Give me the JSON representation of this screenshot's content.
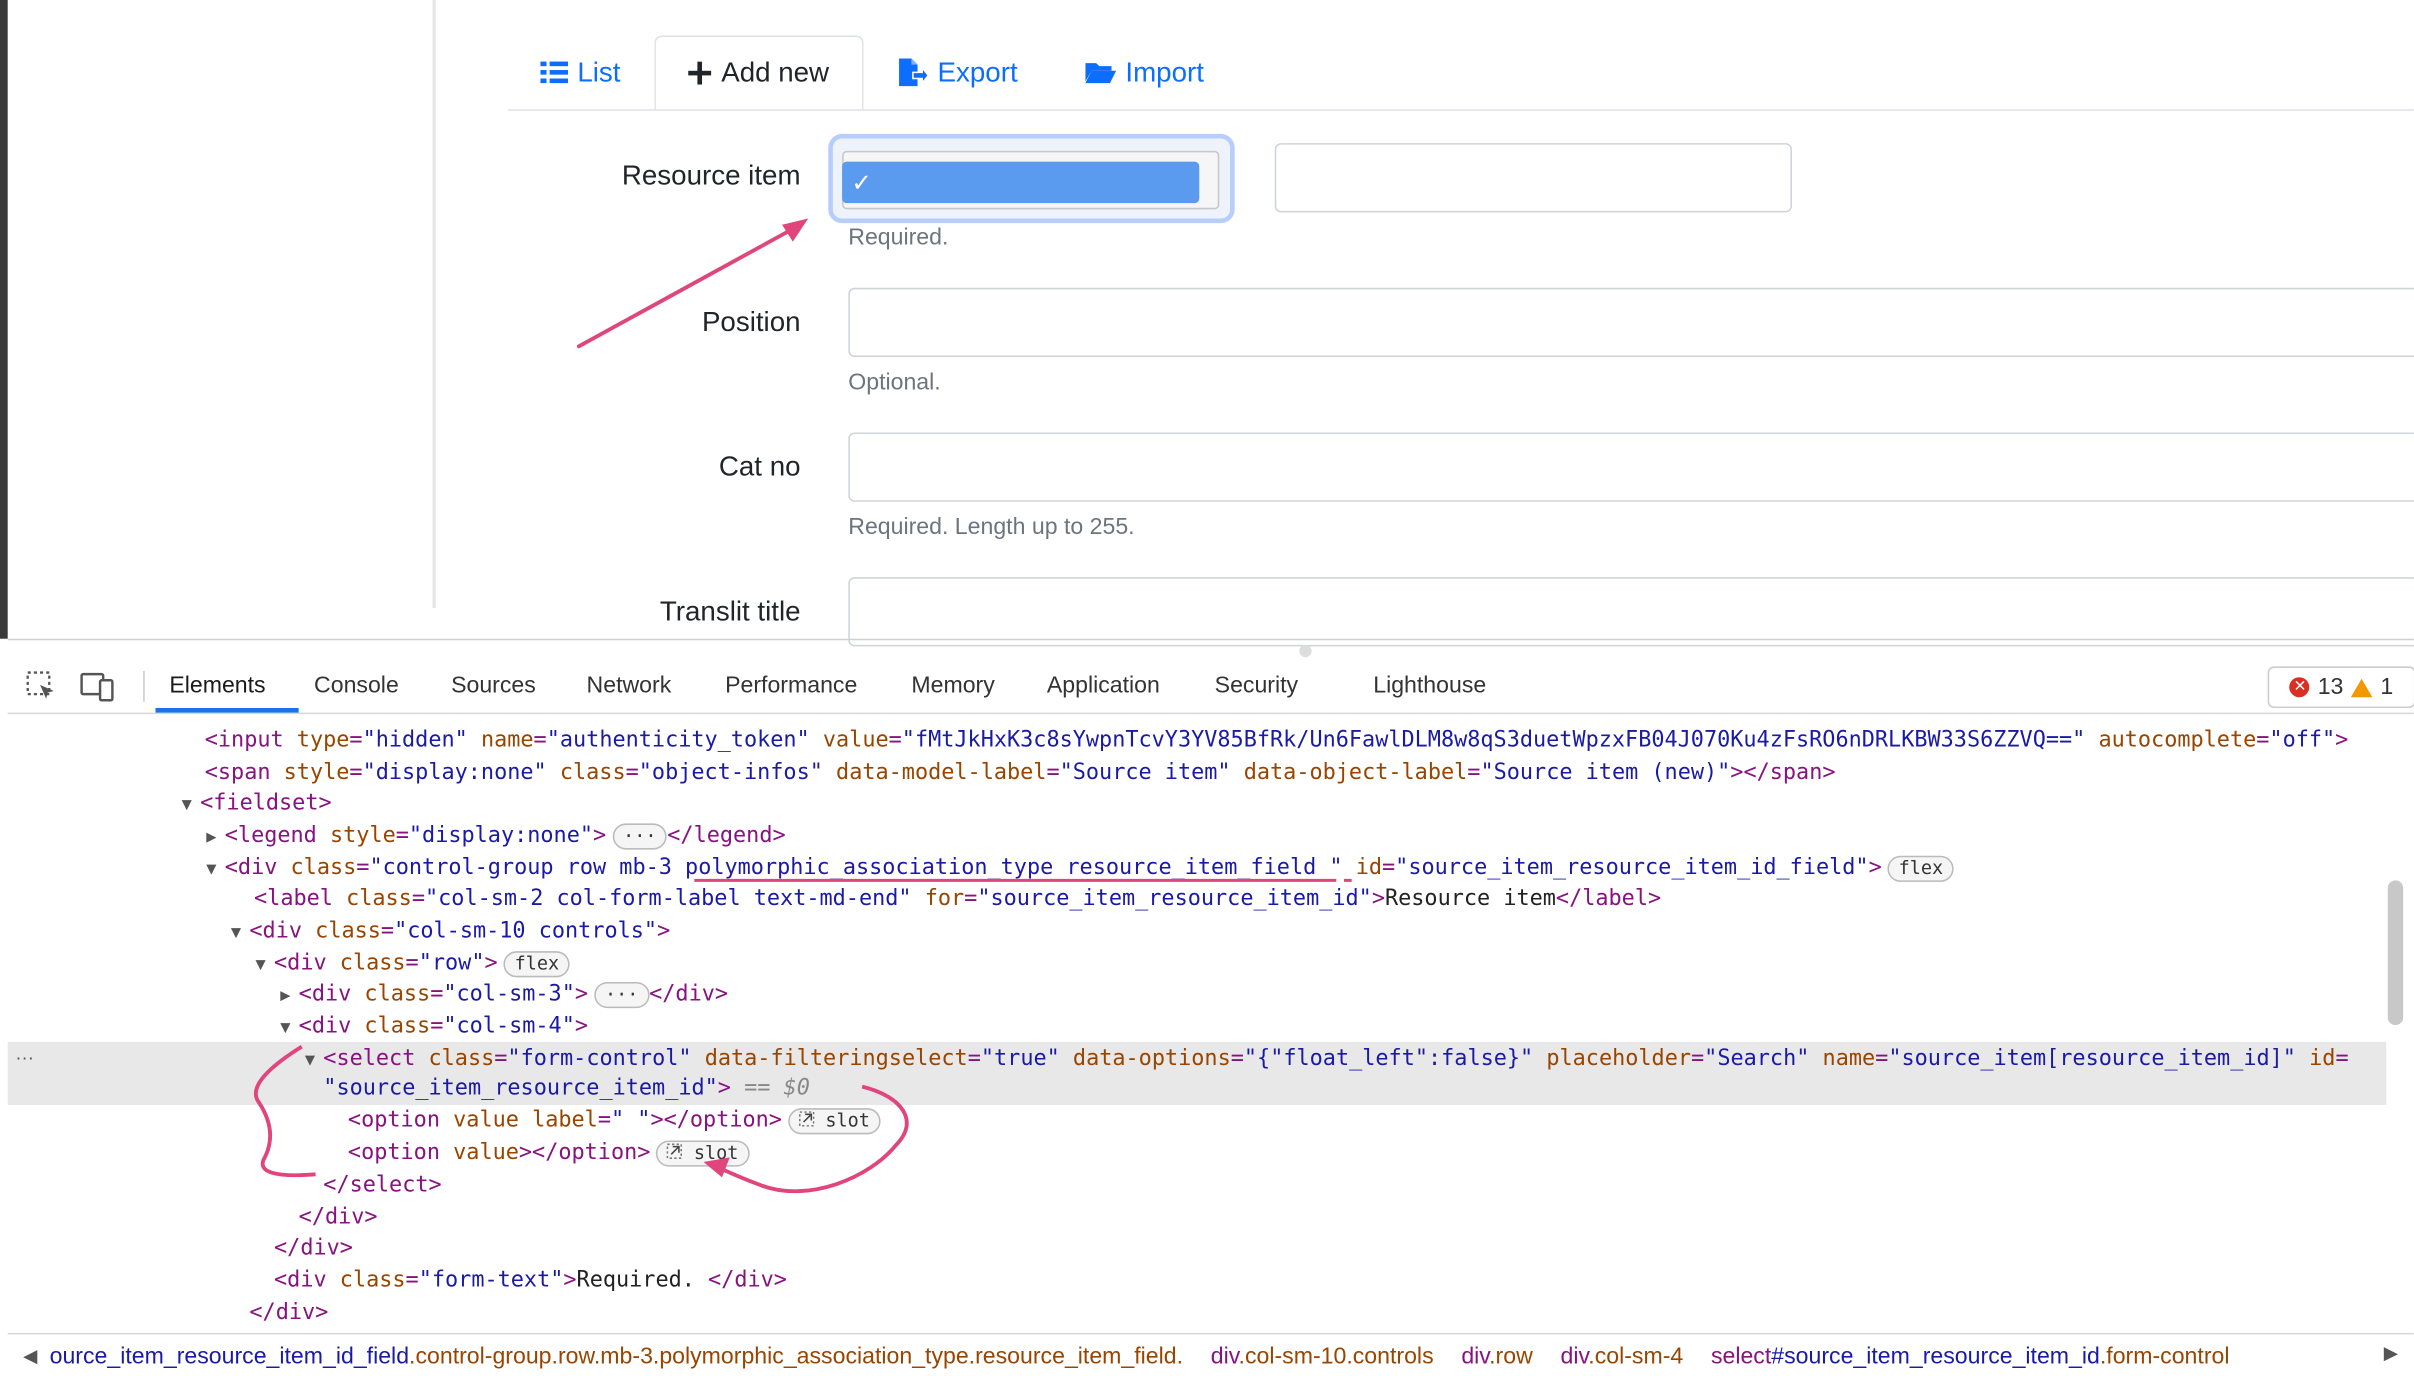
{
  "tabs": {
    "list": "List",
    "add_new": "Add new",
    "export": "Export",
    "import": "Import"
  },
  "form": {
    "resource_item": {
      "label": "Resource item",
      "hint": "Required.",
      "option_mark": "✓"
    },
    "position": {
      "label": "Position",
      "hint": "Optional."
    },
    "cat_no": {
      "label": "Cat no",
      "hint": "Required. Length up to 255."
    },
    "translit_title": {
      "label": "Translit title"
    }
  },
  "devtools": {
    "tabs": [
      "Elements",
      "Console",
      "Sources",
      "Network",
      "Performance",
      "Memory",
      "Application",
      "Security",
      "Lighthouse"
    ],
    "errors": "13",
    "warnings": "1",
    "badges": {
      "flex": "flex",
      "slot": "slot",
      "ellipsis": "···"
    },
    "selected_marker": "== $0",
    "row_dots": "···",
    "breadcrumbs": {
      "c1_tag": "ource_item_resource_item_id_field",
      "c1_cls": ".control-group.row.mb-3.polymorphic_association_type.resource_item_field.",
      "c2_tag": "div",
      "c2_cls": ".col-sm-10.controls",
      "c3_tag": "div",
      "c3_cls": ".row",
      "c4_tag": "div",
      "c4_cls": ".col-sm-4",
      "c5_tag": "select",
      "c5_id": "#source_item_resource_item_id",
      "c5_cls": ".form-control"
    }
  }
}
